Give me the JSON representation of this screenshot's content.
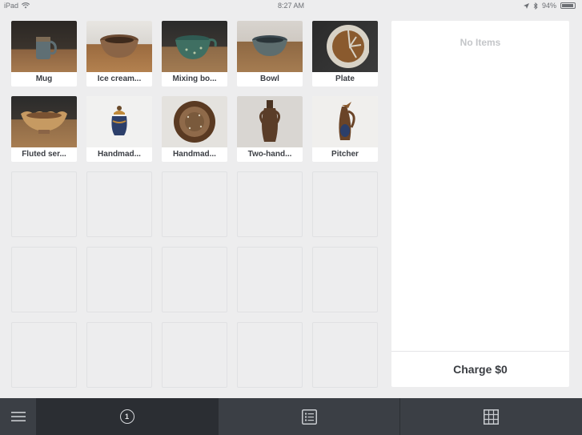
{
  "status_bar": {
    "device": "iPad",
    "time": "8:27 AM",
    "battery_text": "94%",
    "battery_level": 0.94
  },
  "library": {
    "items": [
      {
        "label": "Mug"
      },
      {
        "label": "Ice cream..."
      },
      {
        "label": "Mixing bo..."
      },
      {
        "label": "Bowl"
      },
      {
        "label": "Plate"
      },
      {
        "label": "Fluted ser..."
      },
      {
        "label": "Handmad..."
      },
      {
        "label": "Handmad..."
      },
      {
        "label": "Two-hand..."
      },
      {
        "label": "Pitcher"
      }
    ],
    "empty_slots": 15
  },
  "cart": {
    "empty_text": "No Items",
    "charge_label": "Charge $0"
  },
  "toolbar": {
    "page_number": "1"
  },
  "colors": {
    "background": "#ededee",
    "toolbar": "#3b3f45",
    "toolbar_active": "#2b2e33",
    "panel": "#ffffff"
  },
  "icons": {
    "menu": "hamburger-icon",
    "list": "list-icon",
    "grid": "grid-icon"
  }
}
